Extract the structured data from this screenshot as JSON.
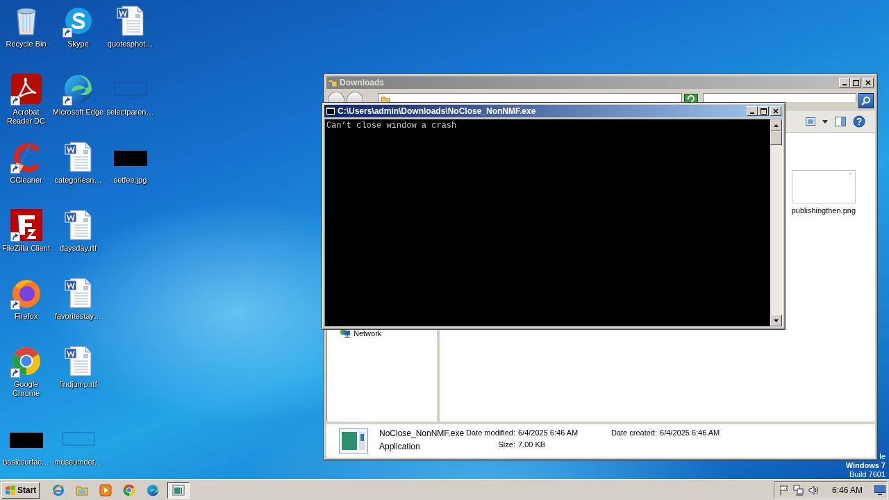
{
  "desktop": {
    "icon_columns": [
      [
        {
          "label": "Recycle Bin",
          "kind": "recycle",
          "shortcut": false
        },
        {
          "label": "Acrobat Reader DC",
          "kind": "acrobat",
          "shortcut": true
        },
        {
          "label": "CCleaner",
          "kind": "ccleaner",
          "shortcut": true
        },
        {
          "label": "FileZilla Client",
          "kind": "filezilla",
          "shortcut": true
        },
        {
          "label": "Firefox",
          "kind": "firefox",
          "shortcut": true
        },
        {
          "label": "Google Chrome",
          "kind": "chrome",
          "shortcut": true
        },
        {
          "label": "basicsurfac…",
          "kind": "black",
          "shortcut": false
        }
      ],
      [
        {
          "label": "Skype",
          "kind": "skype",
          "shortcut": true
        },
        {
          "label": "Microsoft Edge",
          "kind": "edge",
          "shortcut": true
        },
        {
          "label": "categoriesn…",
          "kind": "word",
          "shortcut": false
        },
        {
          "label": "daysday.rtf",
          "kind": "word",
          "shortcut": false
        },
        {
          "label": "favoritestay…",
          "kind": "word",
          "shortcut": false
        },
        {
          "label": "findjump.rtf",
          "kind": "word",
          "shortcut": false
        },
        {
          "label": "museumdet…",
          "kind": "blank",
          "shortcut": false
        }
      ],
      [
        {
          "label": "quotesphot…",
          "kind": "word",
          "shortcut": false
        },
        {
          "label": "selectparen…",
          "kind": "blank",
          "shortcut": false
        },
        {
          "label": "setfee.jpg",
          "kind": "black",
          "shortcut": false
        }
      ]
    ],
    "corner_text": [
      "le",
      "Windows 7",
      "Build 7601"
    ]
  },
  "explorer": {
    "title": "Downloads",
    "active": false,
    "nav_items": [
      {
        "label": "Network"
      }
    ],
    "files": [
      {
        "name": "publishingthen.png"
      }
    ],
    "details": {
      "name": "NoClose_NonNMF.exe",
      "type": "Application",
      "fields": [
        {
          "label": "Date modified:",
          "value": "6/4/2025 6:46 AM"
        },
        {
          "label": "Size:",
          "value": "7.00 KB"
        },
        {
          "label": "Date created:",
          "value": "6/4/2025 6:46 AM"
        }
      ]
    }
  },
  "console": {
    "title": "C:\\Users\\admin\\Downloads\\NoClose_NonNMF.exe",
    "active": true,
    "lines": [
      "Can’t close window a crash"
    ]
  },
  "taskbar": {
    "start": "Start",
    "items": [
      {
        "kind": "ie",
        "selected": false
      },
      {
        "kind": "folder",
        "selected": false
      },
      {
        "kind": "media",
        "selected": false
      },
      {
        "kind": "chrome",
        "selected": false
      },
      {
        "kind": "edge",
        "selected": false
      },
      {
        "kind": "console",
        "selected": true
      }
    ],
    "tray": [
      {
        "kind": "flag"
      },
      {
        "kind": "network"
      },
      {
        "kind": "volume"
      }
    ],
    "clock": "6:46 AM"
  }
}
